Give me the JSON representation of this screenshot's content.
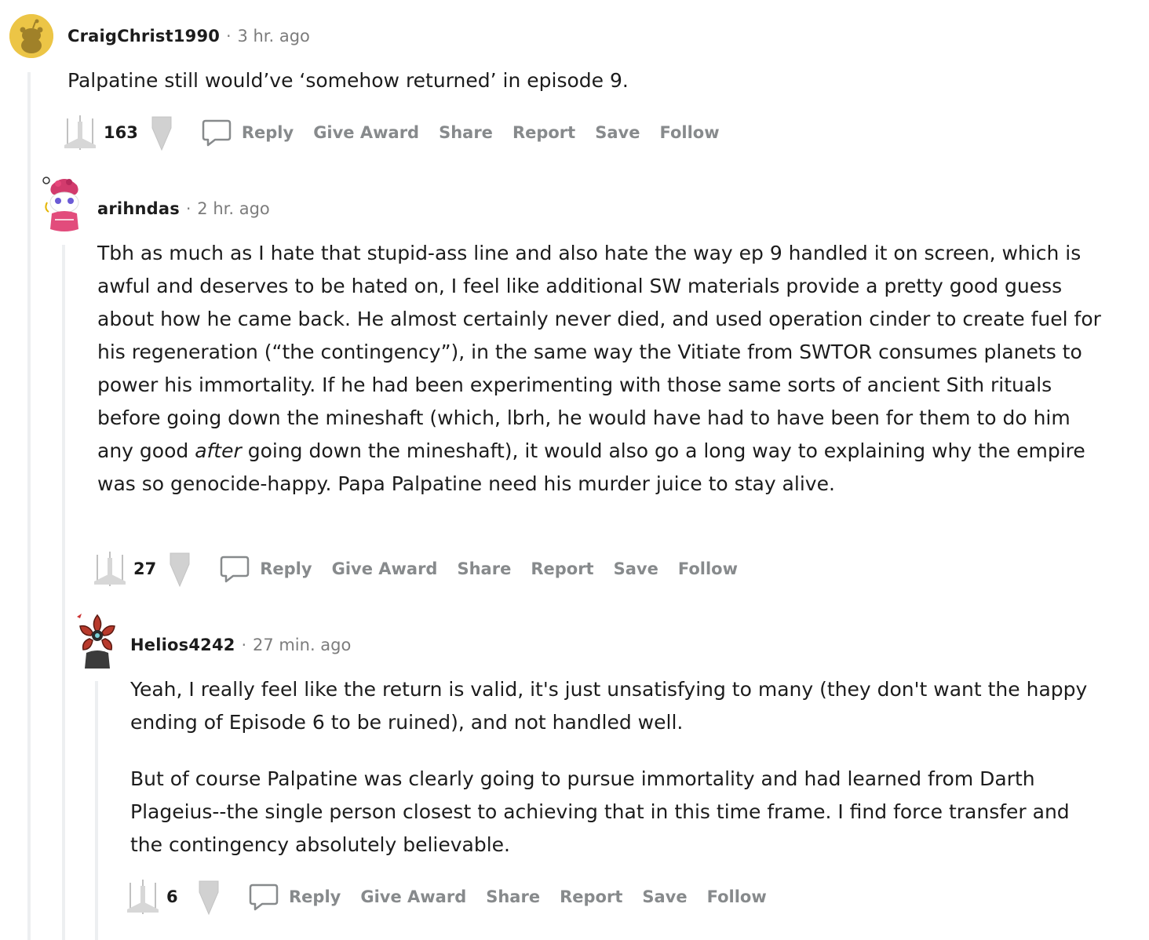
{
  "comments": [
    {
      "author": "CraigChrist1990",
      "separator": "·",
      "time": "3 hr. ago",
      "body": [
        "Palpatine still would’ve ‘somehow returned’ in episode 9."
      ],
      "score": "163",
      "actions": {
        "reply": "Reply",
        "award": "Give Award",
        "share": "Share",
        "report": "Report",
        "save": "Save",
        "follow": "Follow"
      }
    },
    {
      "author": "arihndas",
      "separator": "·",
      "time": "2 hr. ago",
      "body_before_em": "Tbh as much as I hate that stupid-ass line and also hate the way ep 9 handled it on screen, which is awful and deserves to be hated on, I feel like additional SW materials provide a pretty good guess about how he came back. He almost certainly never died, and used operation cinder to create fuel for his regeneration (“the contingency”), in the same way the Vitiate from SWTOR consumes planets to power his immortality. If he had been experimenting with those same sorts of ancient Sith rituals before going down the mineshaft (which, lbrh, he would have had to have been for them to do him any good ",
      "body_em": "after",
      "body_after_em": " going down the mineshaft), it would also go a long way to explaining why the empire was so genocide-happy. Papa Palpatine need his murder juice to stay alive.",
      "score": "27",
      "actions": {
        "reply": "Reply",
        "award": "Give Award",
        "share": "Share",
        "report": "Report",
        "save": "Save",
        "follow": "Follow"
      }
    },
    {
      "author": "Helios4242",
      "separator": "·",
      "time": "27 min. ago",
      "body": [
        "Yeah, I really feel like the return is valid, it's just unsatisfying to many (they don't want the happy ending of Episode 6 to be ruined), and not handled well.",
        "But of course Palpatine was clearly going to pursue immortality and had learned from Darth Plageius--the single person closest to achieving that in this time frame. I find force transfer and the contingency absolutely believable."
      ],
      "score": "6",
      "actions": {
        "reply": "Reply",
        "award": "Give Award",
        "share": "Share",
        "report": "Report",
        "save": "Save",
        "follow": "Follow"
      }
    }
  ],
  "icons": {
    "upvote": "xwing-upvote-icon",
    "downvote": "downvote-icon",
    "reply": "speech-bubble-icon"
  },
  "colors": {
    "meta_gray": "#7c7c7c",
    "action_gray": "#878a8c",
    "thread_line": "#edeff1",
    "avatar1_bg": "#ecc546"
  }
}
